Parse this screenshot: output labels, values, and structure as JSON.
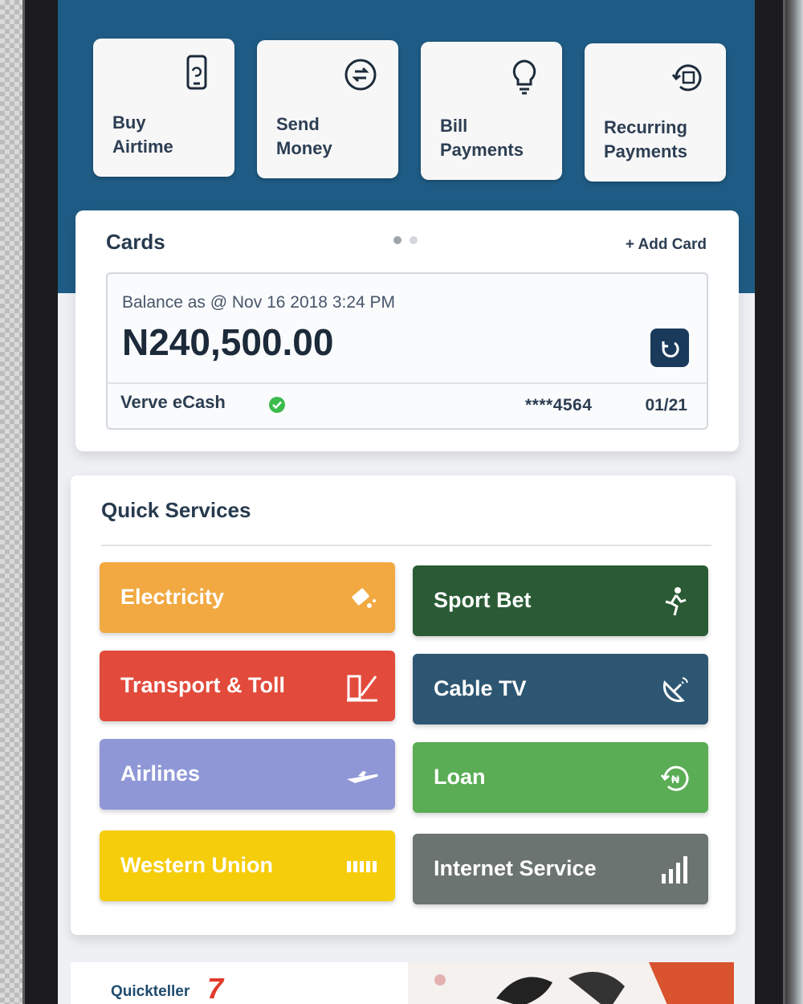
{
  "actions": [
    {
      "label": "Buy\nAirtime",
      "icon": "phone-refresh-icon"
    },
    {
      "label": "Send\nMoney",
      "icon": "transfer-arrows-icon"
    },
    {
      "label": "Bill\nPayments",
      "icon": "lightbulb-icon"
    },
    {
      "label": "Recurring\nPayments",
      "icon": "recurring-calendar-icon"
    }
  ],
  "cards": {
    "title": "Cards",
    "add_label": "+ Add Card",
    "balance_label": "Balance as @ Nov 16 2018 3:24 PM",
    "balance_amount": "N240,500.00",
    "card_name": "Verve eCash",
    "card_number": "****4564",
    "card_expiry": "01/21",
    "pager": {
      "count": 2,
      "active": 1
    }
  },
  "quick_services": {
    "title": "Quick Services",
    "items": [
      {
        "label": "Electricity",
        "icon": "electricity-plug-icon",
        "color": "#f2a942"
      },
      {
        "label": "Sport Bet",
        "icon": "running-person-icon",
        "color": "#2a5b35"
      },
      {
        "label": "Transport & Toll",
        "icon": "toll-gate-icon",
        "color": "#e24a3b"
      },
      {
        "label": "Cable TV",
        "icon": "satellite-dish-icon",
        "color": "#2d5672"
      },
      {
        "label": "Airlines",
        "icon": "airplane-icon",
        "color": "#8f97d6"
      },
      {
        "label": "Loan",
        "icon": "loan-refresh-icon",
        "color": "#5aad55"
      },
      {
        "label": "Western Union",
        "icon": "wu-logo-icon",
        "color": "#f5cd0a"
      },
      {
        "label": "Internet Service",
        "icon": "signal-bars-icon",
        "color": "#6b7470"
      }
    ]
  },
  "banner": {
    "brand": "Quickteller",
    "brand_mark": "7"
  },
  "colors": {
    "header": "#1f5c85",
    "text_dark": "#273a4e"
  }
}
